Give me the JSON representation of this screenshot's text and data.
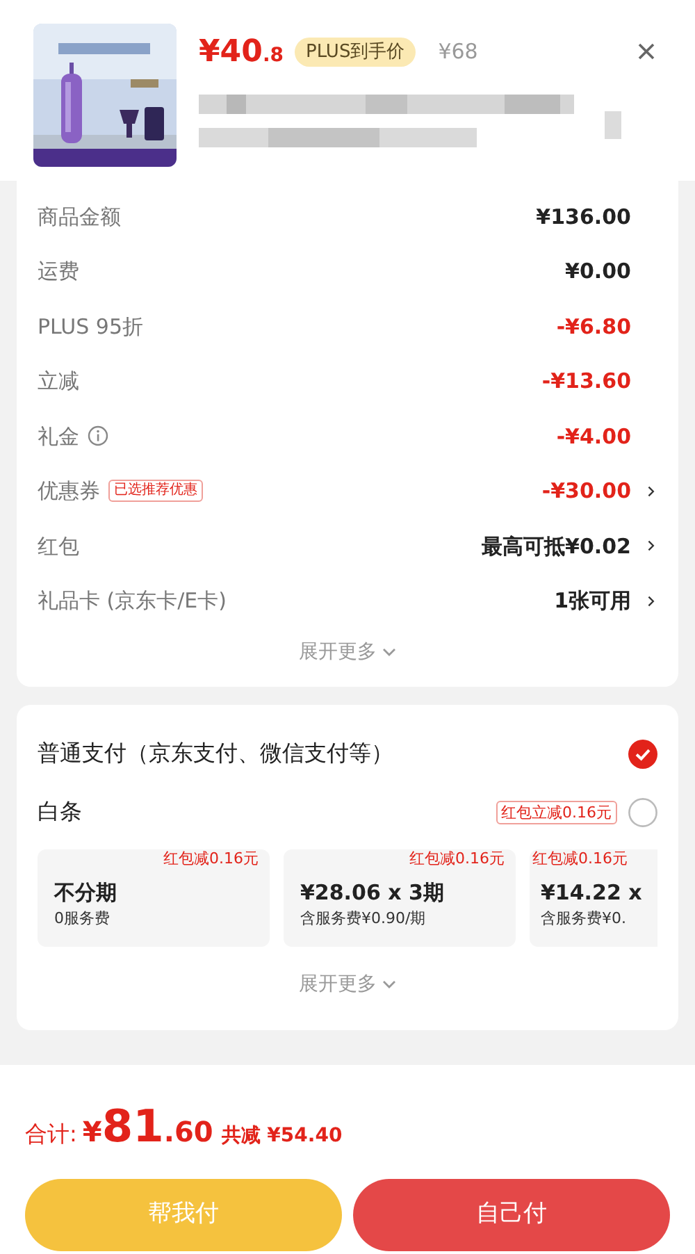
{
  "product": {
    "price_int": "¥40",
    "price_dec": ".8",
    "badge": "PLUS到手价",
    "original_price": "¥68"
  },
  "cost_rows": [
    {
      "label": "商品金额",
      "value": "¥136.00",
      "kind": "normal",
      "has_arrow": false
    },
    {
      "label": "运费",
      "value": "¥0.00",
      "kind": "normal",
      "has_arrow": false
    },
    {
      "label": "PLUS 95折",
      "value": "-¥6.80",
      "kind": "discount",
      "has_arrow": false
    },
    {
      "label": "立减",
      "value": "-¥13.60",
      "kind": "discount",
      "has_arrow": false
    },
    {
      "label": "礼金",
      "info": true,
      "value": "-¥4.00",
      "kind": "discount",
      "has_arrow": false
    },
    {
      "label": "优惠券",
      "tag": "已选推荐优惠",
      "value": "-¥30.00",
      "kind": "discount",
      "has_arrow": true
    },
    {
      "label": "红包",
      "value": "最高可抵¥0.02",
      "kind": "normal",
      "has_arrow": true
    },
    {
      "label": "礼品卡 (京东卡/E卡)",
      "value": "1张可用",
      "kind": "normal",
      "has_arrow": true
    }
  ],
  "cost_expand": "展开更多",
  "payment_options": [
    {
      "label": "普通支付（京东支付、微信支付等）",
      "selected": true
    },
    {
      "label": "白条",
      "tag": "红包立减0.16元",
      "selected": false
    }
  ],
  "installments": [
    {
      "tag": "红包减0.16元",
      "title": "不分期",
      "subtitle": "0服务费"
    },
    {
      "tag": "红包减0.16元",
      "title": "¥28.06 x 3期",
      "subtitle": "含服务费¥0.90/期"
    },
    {
      "tag": "红包减0.16元",
      "title": "¥14.22 x",
      "subtitle": "含服务费¥0."
    }
  ],
  "payment_expand": "展开更多",
  "footer": {
    "total_label": "合计:",
    "currency": "¥",
    "total_int": "81",
    "total_dec": ".60",
    "saved": "共减 ¥54.40"
  },
  "buttons": [
    {
      "label": "帮我付",
      "kind": "friend"
    },
    {
      "label": "自己付",
      "kind": "self"
    }
  ]
}
